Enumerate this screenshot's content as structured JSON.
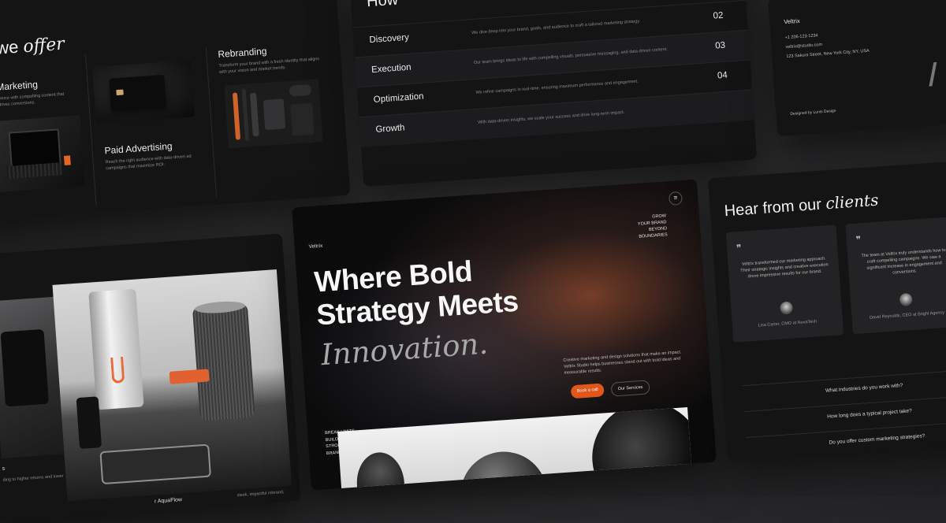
{
  "services": {
    "title_plain": "we",
    "title_italic": "offer",
    "content_marketing": {
      "name": "t Marketing",
      "desc_1": "audience with compelling content that",
      "desc_2": "nd drives conversions."
    },
    "paid_advertising": {
      "name": "Paid Advertising",
      "desc_1": "Reach the right audience with data-driven ad",
      "desc_2": "campaigns that maximize ROI."
    },
    "rebranding": {
      "name": "Rebranding",
      "desc_1": "Transform your brand with a fresh identity that aligns",
      "desc_2": "with your vision and market trends."
    }
  },
  "process": {
    "header": "How",
    "rows": [
      {
        "name": "Discovery",
        "desc": "We dive deep into your brand, goals, and audience to craft a tailored marketing strategy.",
        "num": "02"
      },
      {
        "name": "Execution",
        "desc": "Our team brings ideas to life with compelling visuals, persuasive messaging, and data-driven content.",
        "num": "03"
      },
      {
        "name": "Optimization",
        "desc": "We refine campaigns in real-time, ensuring maximum performance and engagement.",
        "num": "04"
      },
      {
        "name": "Growth",
        "desc": "With data-driven insights, we scale your success and drive long-term impact.",
        "num": ""
      }
    ]
  },
  "contact": {
    "brand": "Veltrix",
    "phone": "+1 206-123-1234",
    "email": "veltrix@studio.com",
    "address": "123 Sakura Street, New York City, NY, USA",
    "credit": "Designed by Lunis Design"
  },
  "gallery": {
    "caption_left_1": "s",
    "caption_left_2": "ding to higher returns and lower",
    "caption_bottom": "r AquaFlow",
    "caption_right": "sleek, impactful rebrand,"
  },
  "hero": {
    "logo": "Veltrix",
    "menu_icon": "≡",
    "tagline": [
      "GROW",
      "YOUR BRAND",
      "BEYOND",
      "BOUNDARIES"
    ],
    "headline_1": "Where Bold",
    "headline_2": "Strategy Meets",
    "headline_italic": "Innovation.",
    "description": "Creative marketing and design solutions that make an impact. Veltrix Studio helps businesses stand out with bold ideas and measurable results.",
    "cta_primary": "Book a call",
    "cta_secondary": "Our Services",
    "break_limits": [
      "BREAK LIMITS",
      "BUILD",
      "STRONGER",
      "BRANDS"
    ],
    "accent_color": "#e1561b"
  },
  "testimonials": {
    "title_plain": "Hear from our",
    "title_italic": "clients",
    "quote_mark": "❞",
    "items": [
      {
        "quote": "Veltrix transformed our marketing approach. Their strategic insights and creative execution drove impressive results for our brand.",
        "author": "Lisa Carter, CMO at NovaTech"
      },
      {
        "quote": "The team at Veltrix truly understands how to craft compelling campaigns. We saw a significant increase in engagement and conversions.",
        "author": "David Reynolds, CEO at Bright Agency"
      }
    ],
    "faq": [
      "What industries do you work with?",
      "How long does a typical project take?",
      "Do you offer custom marketing strategies?"
    ]
  }
}
